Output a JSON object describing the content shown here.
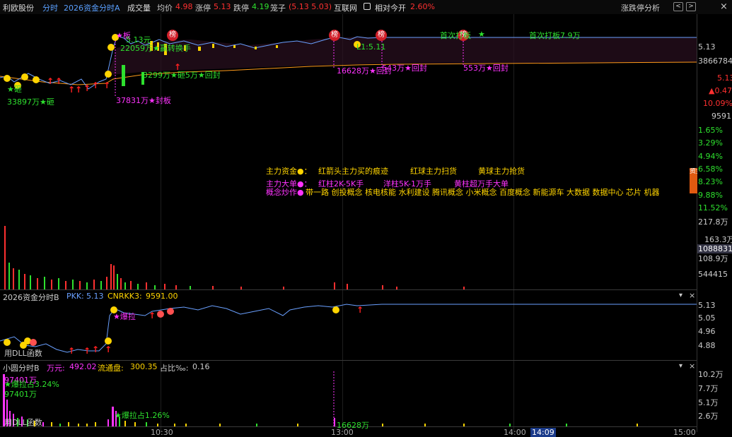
{
  "topbar": {
    "stock_name": "利欧股份",
    "tab_fenshi": "分时",
    "indicator": "2026资金分时A",
    "volume_label": "成交量",
    "avg_label": "均价",
    "avg_value": "4.98",
    "limit_up_label": "涨停",
    "limit_up_value": "5.13",
    "limit_down_label": "跌停",
    "limit_down_value": "4.19",
    "cage_label": "笼子",
    "cage_value": "(5.13 5.03)",
    "sector": "互联网",
    "relative_label": "相对今开",
    "relative_value": "2.60%",
    "analysis_label": "涨跌停分析"
  },
  "right_axis": {
    "main": [
      "5.13",
      "3866784",
      "5.13",
      "▲0.47",
      "10.09%",
      "9591"
    ],
    "pct": [
      "1.65%",
      "3.29%",
      "4.94%",
      "6.58%",
      "8.23%",
      "9.88%",
      "11.52%"
    ],
    "vol": [
      "217.8万",
      "163.3万",
      "1088831",
      "108.9万",
      "544415"
    ],
    "panel2": [
      "5.13",
      "5.05",
      "4.96",
      "4.88"
    ],
    "panel3": [
      "10.2万",
      "7.7万",
      "5.1万",
      "2.6万"
    ]
  },
  "main_annotations": {
    "a1": "★砸",
    "a2": "33897万★砸",
    "a3": "★板",
    "a4": "5.13元",
    "a5": "22059万★赢转换手",
    "a6": "3299万★砸5万★回封",
    "a7": "37831万★封板",
    "a8": "L1:5.11",
    "a9": "16628万★回封",
    "a10": "543万★回封",
    "a11": "553万★回封",
    "a12": "首次打板",
    "a13": "首次打板7.9万",
    "badge": "榜"
  },
  "legend": {
    "row1_title": "主力资金●：",
    "row1_a": "红箭头主力买的痕迹",
    "row1_b": "红球主力扫货",
    "row1_c": "黄球主力抢货",
    "row2_title": "主力大单●：",
    "row2_a": "红柱2K-5K手",
    "row2_b": "洋柱5K-1万手",
    "row2_c": "黄柱超万手大单",
    "concept_title": "概念炒作●",
    "concepts": "带一路 创投概念 核电核能 水利建设 腾讯概念 小米概念 百度概念 新能源车 大数据 数据中心 芯片 机器",
    "side_tag": "资金"
  },
  "panel2": {
    "title": "2026资金分时B",
    "pkk_label": "PKK:",
    "pkk_value": "5.13",
    "cnrkk_label": "CNRKK3:",
    "cnrkk_value": "9591.00",
    "ann1": "★爆拉",
    "footer": "用DLL函数"
  },
  "panel3": {
    "title": "小圆分时B",
    "wan_label": "万元:",
    "wan_value": "492.02",
    "float_label": "流通盘:",
    "float_value": "300.35",
    "ratio_label": "占比‰:",
    "ratio_value": "0.16",
    "ann1": "97401万",
    "ann2": "★爆拉占3.24%",
    "ann3": "97401万",
    "ann4": "★爆拉占1.26%",
    "ann5": "16628万",
    "footer": "用DLL函数"
  },
  "x_axis": [
    "10:30",
    "13:00",
    "14:00",
    "14:09",
    "15:00"
  ],
  "colors": {
    "up": "#ff3030",
    "down": "#2ee02e",
    "yellow": "#ffd400",
    "magenta": "#ff33ff",
    "line_blue": "#6aa0ff",
    "avg_orange": "#ff9a1a"
  }
}
